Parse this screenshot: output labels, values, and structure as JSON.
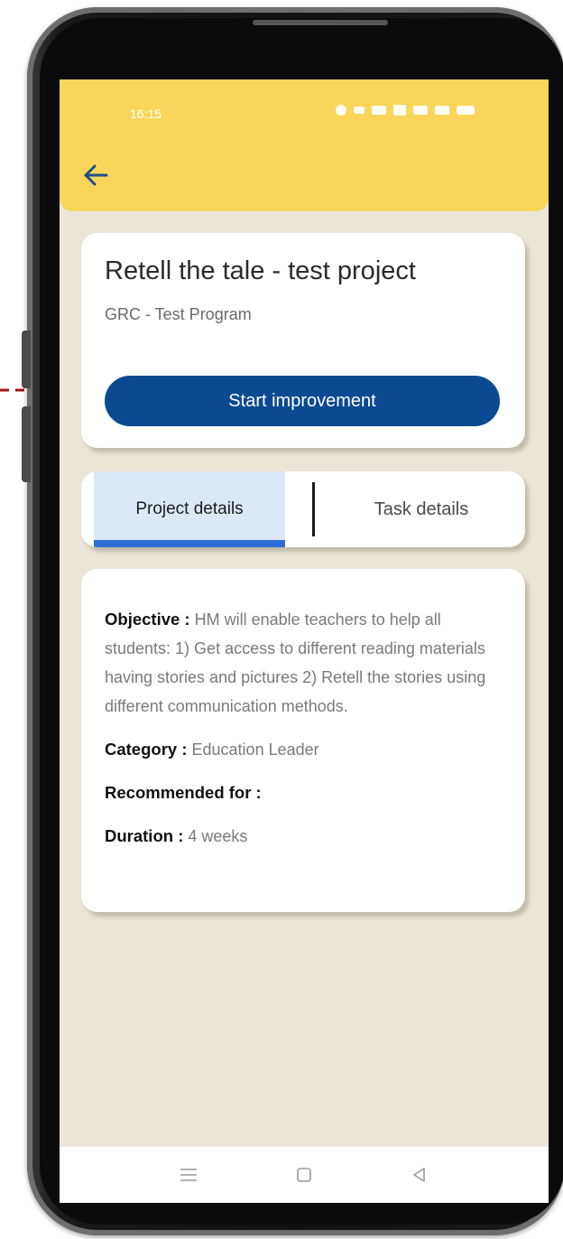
{
  "status_bar": {
    "time": "16:15"
  },
  "header": {
    "back_icon": "arrow-left-icon",
    "accent": "#f9d65a"
  },
  "project": {
    "title": "Retell the tale - test project",
    "program": "GRC - Test Program",
    "start_button_label": "Start improvement",
    "button_color": "#0b4a91"
  },
  "tabs": [
    {
      "label": "Project details",
      "active": true
    },
    {
      "label": "Task details",
      "active": false
    }
  ],
  "details": {
    "objective_label": "Objective :",
    "objective_value": "HM will enable teachers to help all students: 1) Get access to different reading materials having stories and pictures 2) Retell the stories using different communication methods.",
    "category_label": "Category :",
    "category_value": "Education Leader",
    "recommended_label": "Recommended for :",
    "recommended_value": "",
    "duration_label": "Duration :",
    "duration_value": "4 weeks"
  },
  "nav": {
    "menu_icon": "menu-icon",
    "home_icon": "home-square-icon",
    "back_icon": "back-triangle-icon"
  }
}
